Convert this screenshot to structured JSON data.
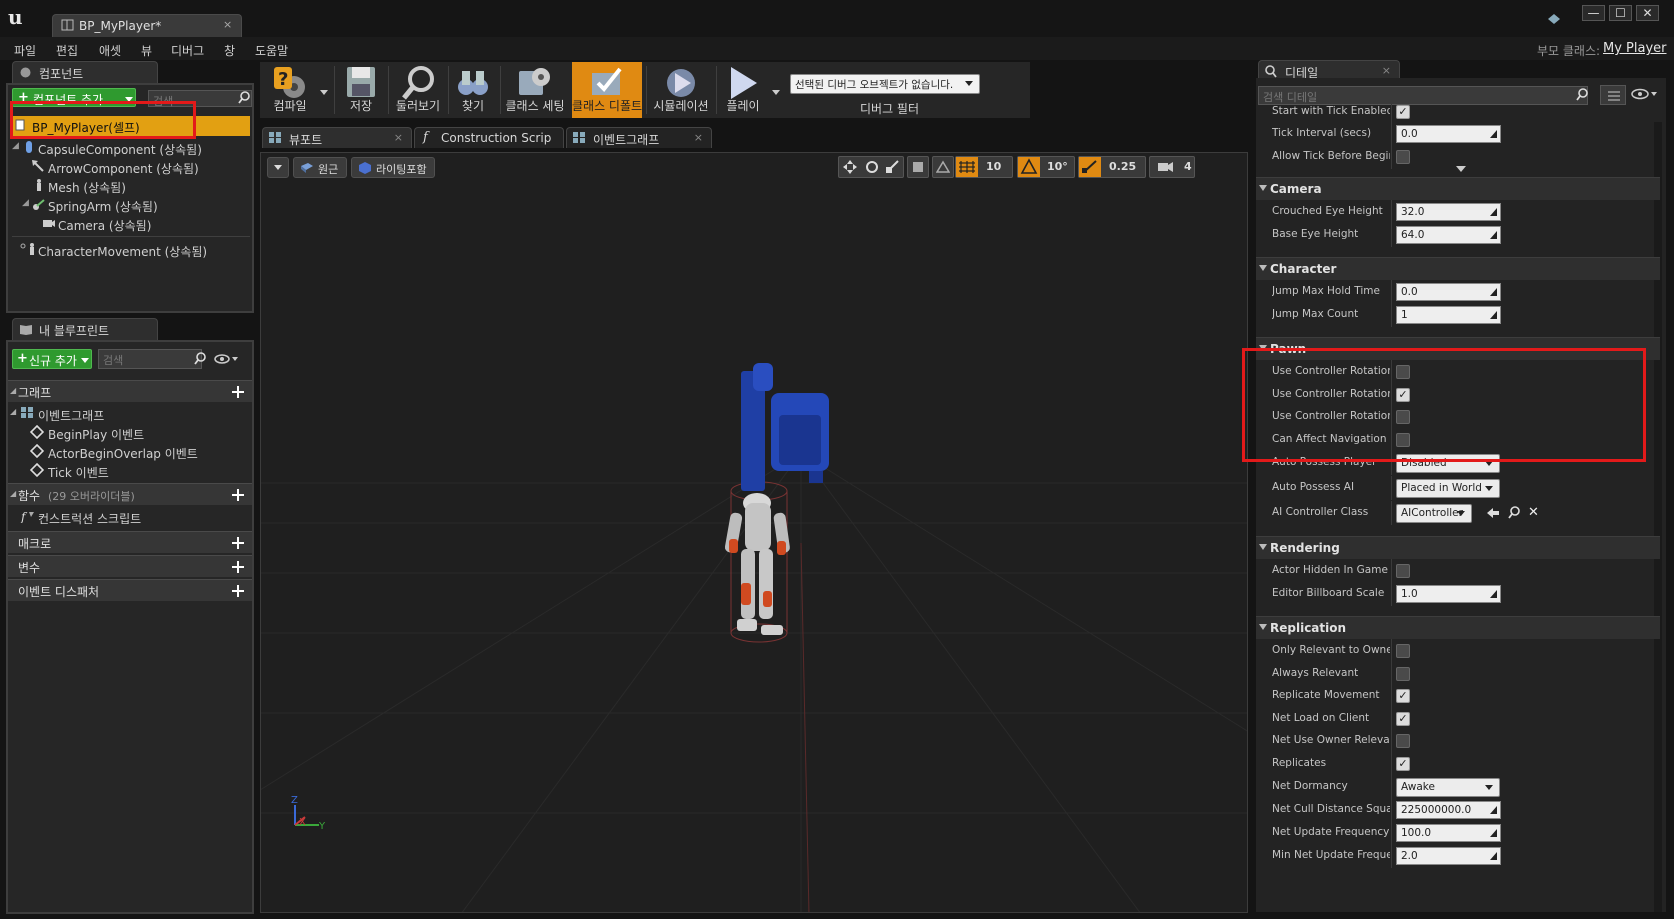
{
  "colors": {
    "accent": "#e08a12",
    "highlight_red": "#e31a1a",
    "selected_row": "#e2a012",
    "add_green": "#2f9a2f"
  },
  "title_tab": {
    "label": "BP_MyPlayer*",
    "close": "×",
    "icon": "blueprint-icon"
  },
  "window_buttons": {
    "minimize": "—",
    "maximize": "☐",
    "close": "✕"
  },
  "menu": [
    "파일",
    "편집",
    "애셋",
    "뷰",
    "디버그",
    "창",
    "도움말"
  ],
  "parent_class": {
    "label": "부모 클래스:",
    "value": "My Player"
  },
  "components_panel": {
    "tab_label": "컴포넌트",
    "add_button": "컴포넌트 추가",
    "search_placeholder": "검색",
    "root": "BP_MyPlayer(셀프)",
    "items": [
      "CapsuleComponent (상속됨)",
      "ArrowComponent (상속됨)",
      "Mesh (상속됨)",
      "SpringArm (상속됨)",
      "Camera (상속됨)",
      "CharacterMovement (상속됨)"
    ]
  },
  "blueprint_panel": {
    "tab_label": "내 블루프린트",
    "add_button": "신규 추가",
    "search_placeholder": "검색",
    "graph_header": "그래프",
    "event_graph": "이벤트그래프",
    "events": [
      "BeginPlay 이벤트",
      "ActorBeginOverlap 이벤트",
      "Tick 이벤트"
    ],
    "functions_header": "함수",
    "functions_count": "(29 오버라이더블)",
    "construction_script": "컨스트럭션 스크립트",
    "macros_header": "매크로",
    "variables_header": "변수",
    "dispatchers_header": "이벤트 디스패처"
  },
  "toolbar": {
    "compile": "컴파일",
    "save": "저장",
    "browse": "둘러보기",
    "find": "찾기",
    "class_settings": "클래스 세팅",
    "class_defaults": "클래스 디폴트",
    "simulation": "시뮬레이션",
    "play": "플레이",
    "debug_select": "선택된 디버그 오브젝트가 없습니다.",
    "debug_filter": "디버그 필터"
  },
  "editor_tabs": [
    "뷰포트",
    "Construction Scrip",
    "이벤트그래프"
  ],
  "viewport": {
    "perspective": "원근",
    "lit": "라이팅포함",
    "grid_snap": "10",
    "rot_snap": "10°",
    "scale_snap": "0.25",
    "cam_speed": "4",
    "axis_z": "Z",
    "axis_x": "X",
    "axis_y": "Y"
  },
  "details_panel": {
    "tab_label": "디테일",
    "search_placeholder": "검색 디테일",
    "top_rows": [
      {
        "label": "Start with Tick Enabled",
        "type": "check",
        "value": true
      },
      {
        "label": "Tick Interval (secs)",
        "type": "num",
        "value": "0.0"
      },
      {
        "label": "Allow Tick Before Begin",
        "type": "check",
        "value": false
      }
    ],
    "camera": {
      "header": "Camera",
      "rows": [
        {
          "label": "Crouched Eye Height",
          "value": "32.0"
        },
        {
          "label": "Base Eye Height",
          "value": "64.0"
        }
      ]
    },
    "character": {
      "header": "Character",
      "rows": [
        {
          "label": "Jump Max Hold Time",
          "value": "0.0"
        },
        {
          "label": "Jump Max Count",
          "value": "1"
        }
      ]
    },
    "pawn": {
      "header": "Pawn",
      "rows": [
        {
          "label": "Use Controller Rotation P",
          "value": false
        },
        {
          "label": "Use Controller Rotation Y",
          "value": true
        },
        {
          "label": "Use Controller Rotation R",
          "value": false
        },
        {
          "label": "Can Affect Navigation G",
          "value": false
        }
      ],
      "auto_possess_player": {
        "label": "Auto Possess Player",
        "value": "Disabled"
      },
      "auto_possess_ai": {
        "label": "Auto Possess AI",
        "value": "Placed in World"
      },
      "ai_controller_class": {
        "label": "AI Controller Class",
        "value": "AIController"
      }
    },
    "rendering": {
      "header": "Rendering",
      "hidden": {
        "label": "Actor Hidden In Game",
        "value": false
      },
      "billboard": {
        "label": "Editor Billboard Scale",
        "value": "1.0"
      }
    },
    "replication": {
      "header": "Replication",
      "checks": [
        {
          "label": "Only Relevant to Owner",
          "value": false
        },
        {
          "label": "Always Relevant",
          "value": false
        },
        {
          "label": "Replicate Movement",
          "value": true
        },
        {
          "label": "Net Load on Client",
          "value": true
        },
        {
          "label": "Net Use Owner Relevanc",
          "value": false
        },
        {
          "label": "Replicates",
          "value": true
        }
      ],
      "dormancy": {
        "label": "Net Dormancy",
        "value": "Awake"
      },
      "cull": {
        "label": "Net Cull Distance Squar",
        "value": "225000000.0"
      },
      "update_freq": {
        "label": "Net Update Frequency",
        "value": "100.0"
      },
      "min_update": {
        "label": "Min Net Update Frequen",
        "value": "2.0"
      }
    }
  }
}
